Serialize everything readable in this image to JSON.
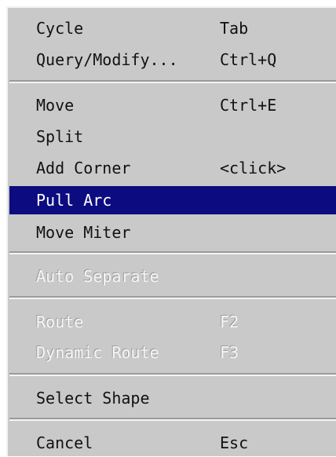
{
  "menu": {
    "items": [
      {
        "label": "Cycle",
        "shortcut": "Tab"
      },
      {
        "label": "Query/Modify...",
        "shortcut": "Ctrl+Q"
      },
      {
        "label": "Move",
        "shortcut": "Ctrl+E"
      },
      {
        "label": "Split",
        "shortcut": ""
      },
      {
        "label": "Add Corner",
        "shortcut": "<click>"
      },
      {
        "label": "Pull Arc",
        "shortcut": "",
        "state": "highlighted"
      },
      {
        "label": "Move Miter",
        "shortcut": ""
      },
      {
        "label": "Auto Separate",
        "shortcut": "",
        "state": "disabled"
      },
      {
        "label": "Route",
        "shortcut": "F2",
        "state": "disabled"
      },
      {
        "label": "Dynamic Route",
        "shortcut": "F3",
        "state": "disabled"
      },
      {
        "label": "Select Shape",
        "shortcut": ""
      },
      {
        "label": "Cancel",
        "shortcut": "Esc"
      }
    ]
  },
  "colors": {
    "menu_background": "#c9c9c9",
    "highlight_background": "#0c0c80",
    "highlight_text": "#ffffff",
    "text": "#111111"
  }
}
